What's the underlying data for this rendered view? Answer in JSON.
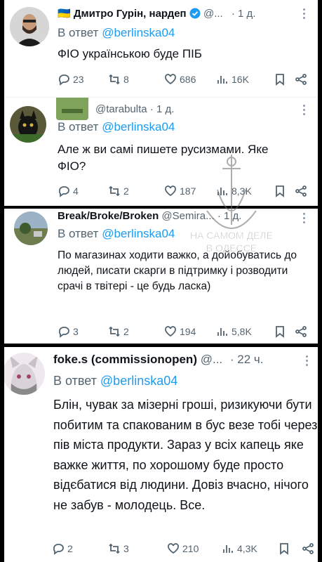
{
  "tweets": [
    {
      "name": "Дмитро Гурін, нардеп",
      "flag": "🇺🇦",
      "verified": true,
      "handle": "@...",
      "time": "· 1 д.",
      "reply_label": "В ответ",
      "reply_to": "@berlinska04",
      "text": "ФІО українською буде ПІБ",
      "replies": "23",
      "retweets": "8",
      "likes": "686",
      "views": "16K"
    },
    {
      "name": "",
      "handle": "@tarabulta",
      "time": "· 1 д.",
      "reply_label": "В ответ",
      "reply_to": "@berlinska04",
      "text": "Але ж ви самі пишете русизмами. Яке ФІО?",
      "replies": "4",
      "retweets": "2",
      "likes": "187",
      "views": "8,3K"
    },
    {
      "name": "Break/Broke/Broken",
      "handle": "@Semira...",
      "time": "· 1 д.",
      "reply_label": "В ответ",
      "reply_to": "@berlinska04",
      "text": "По магазинах ходити важко, а дойобуватись до людей, писати скарги в підтримку і розводити срачі в твітері - це будь ласка)",
      "replies": "3",
      "retweets": "2",
      "likes": "194",
      "views": "5,8K"
    },
    {
      "name": "foke.s (commissionopen)",
      "handle": "@...",
      "time": "· 22 ч.",
      "reply_label": "В ответ",
      "reply_to": "@berlinska04",
      "text": "Блін, чувак за мізерні гроші, ризикуючи бути побитим та спакованим в бус везе тобі через пів міста продукти. Зараз у всіх капець яке важке життя, по хорошому буде просто відєбатися від людини. Довіз вчасно, нічого не забув - молодець. Все.",
      "replies": "2",
      "retweets": "3",
      "likes": "210",
      "views": "4,3K"
    }
  ],
  "watermark": {
    "line1": "НА САМОМ ДЕЛЕ",
    "line2": "В ОДЕССЕ"
  },
  "colors": {
    "link": "#1d9bf0",
    "muted": "#536471",
    "text": "#0f1419",
    "verified": "#1d9bf0"
  },
  "icons": [
    "reply-icon",
    "retweet-icon",
    "like-icon",
    "views-icon",
    "bookmark-icon",
    "share-icon",
    "verified-badge-icon",
    "more-icon"
  ]
}
